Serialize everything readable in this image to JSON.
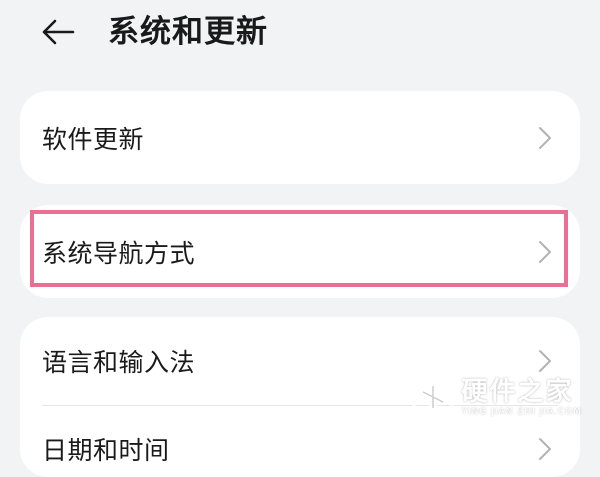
{
  "header": {
    "title": "系统和更新",
    "back_icon": "back-arrow-icon"
  },
  "settings": {
    "card1": [
      {
        "label": "软件更新",
        "icon": "chevron-right-icon"
      }
    ],
    "card2": [
      {
        "label": "系统导航方式",
        "icon": "chevron-right-icon",
        "highlighted": true
      }
    ],
    "card3": [
      {
        "label": "语言和输入法",
        "icon": "chevron-right-icon"
      },
      {
        "label": "日期和时间",
        "icon": "chevron-right-icon"
      }
    ]
  },
  "highlight": {
    "color": "#ea6f92"
  },
  "watermark": {
    "main": "硬件之家",
    "sub": "YING JIAN ZHI JIA.COM",
    "icon": "watermark-logo-icon"
  }
}
